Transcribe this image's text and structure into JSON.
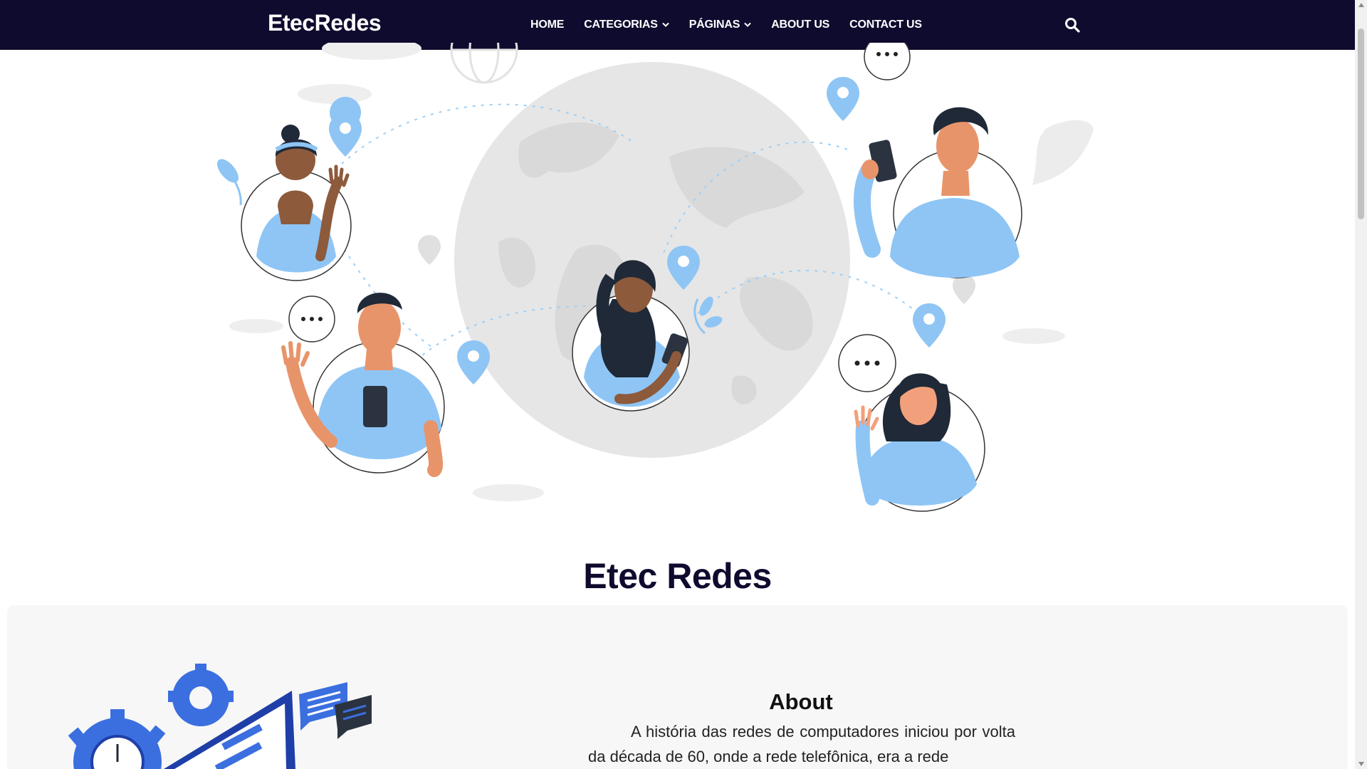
{
  "navbar": {
    "brand": "EtecRedes",
    "links": [
      {
        "label": "HOME",
        "has_dropdown": false
      },
      {
        "label": "CATEGORIAS",
        "has_dropdown": true
      },
      {
        "label": "PÁGINAS",
        "has_dropdown": true
      },
      {
        "label": "ABOUT US",
        "has_dropdown": false
      },
      {
        "label": "CONTACT US",
        "has_dropdown": false
      }
    ],
    "search_icon": "search-icon"
  },
  "hero": {
    "illustration": "people-connected-around-globe"
  },
  "main": {
    "title": "Etec Redes"
  },
  "about": {
    "title": "About",
    "text": "A história das redes de computadores iniciou por volta da década de 60, onde a rede telefônica, era a rede",
    "illustration": "isometric-gears-and-chat"
  },
  "colors": {
    "navbar_bg": "#0f0b2e",
    "accent_blue": "#8ec5f5",
    "title_color": "#0f0b2e",
    "panel_bg": "#f7f7f7"
  }
}
